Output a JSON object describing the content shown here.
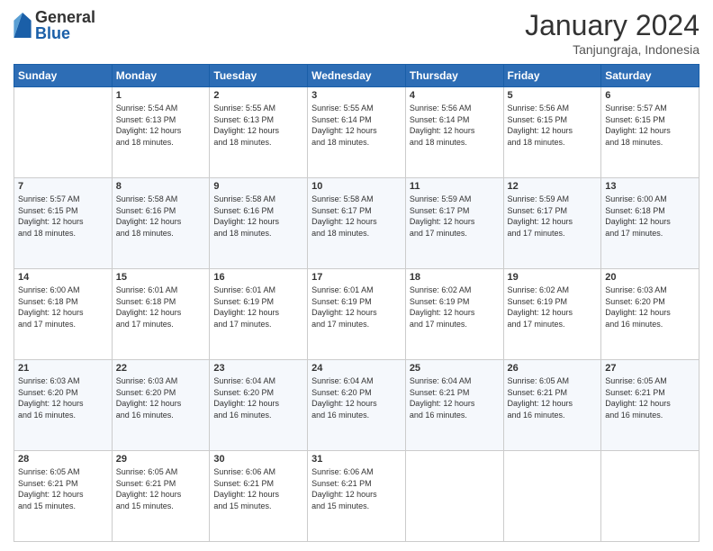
{
  "logo": {
    "general": "General",
    "blue": "Blue"
  },
  "header": {
    "month_year": "January 2024",
    "location": "Tanjungraja, Indonesia"
  },
  "weekdays": [
    "Sunday",
    "Monday",
    "Tuesday",
    "Wednesday",
    "Thursday",
    "Friday",
    "Saturday"
  ],
  "weeks": [
    [
      {
        "day": "",
        "info": ""
      },
      {
        "day": "1",
        "info": "Sunrise: 5:54 AM\nSunset: 6:13 PM\nDaylight: 12 hours\nand 18 minutes."
      },
      {
        "day": "2",
        "info": "Sunrise: 5:55 AM\nSunset: 6:13 PM\nDaylight: 12 hours\nand 18 minutes."
      },
      {
        "day": "3",
        "info": "Sunrise: 5:55 AM\nSunset: 6:14 PM\nDaylight: 12 hours\nand 18 minutes."
      },
      {
        "day": "4",
        "info": "Sunrise: 5:56 AM\nSunset: 6:14 PM\nDaylight: 12 hours\nand 18 minutes."
      },
      {
        "day": "5",
        "info": "Sunrise: 5:56 AM\nSunset: 6:15 PM\nDaylight: 12 hours\nand 18 minutes."
      },
      {
        "day": "6",
        "info": "Sunrise: 5:57 AM\nSunset: 6:15 PM\nDaylight: 12 hours\nand 18 minutes."
      }
    ],
    [
      {
        "day": "7",
        "info": "Sunrise: 5:57 AM\nSunset: 6:15 PM\nDaylight: 12 hours\nand 18 minutes."
      },
      {
        "day": "8",
        "info": "Sunrise: 5:58 AM\nSunset: 6:16 PM\nDaylight: 12 hours\nand 18 minutes."
      },
      {
        "day": "9",
        "info": "Sunrise: 5:58 AM\nSunset: 6:16 PM\nDaylight: 12 hours\nand 18 minutes."
      },
      {
        "day": "10",
        "info": "Sunrise: 5:58 AM\nSunset: 6:17 PM\nDaylight: 12 hours\nand 18 minutes."
      },
      {
        "day": "11",
        "info": "Sunrise: 5:59 AM\nSunset: 6:17 PM\nDaylight: 12 hours\nand 17 minutes."
      },
      {
        "day": "12",
        "info": "Sunrise: 5:59 AM\nSunset: 6:17 PM\nDaylight: 12 hours\nand 17 minutes."
      },
      {
        "day": "13",
        "info": "Sunrise: 6:00 AM\nSunset: 6:18 PM\nDaylight: 12 hours\nand 17 minutes."
      }
    ],
    [
      {
        "day": "14",
        "info": "Sunrise: 6:00 AM\nSunset: 6:18 PM\nDaylight: 12 hours\nand 17 minutes."
      },
      {
        "day": "15",
        "info": "Sunrise: 6:01 AM\nSunset: 6:18 PM\nDaylight: 12 hours\nand 17 minutes."
      },
      {
        "day": "16",
        "info": "Sunrise: 6:01 AM\nSunset: 6:19 PM\nDaylight: 12 hours\nand 17 minutes."
      },
      {
        "day": "17",
        "info": "Sunrise: 6:01 AM\nSunset: 6:19 PM\nDaylight: 12 hours\nand 17 minutes."
      },
      {
        "day": "18",
        "info": "Sunrise: 6:02 AM\nSunset: 6:19 PM\nDaylight: 12 hours\nand 17 minutes."
      },
      {
        "day": "19",
        "info": "Sunrise: 6:02 AM\nSunset: 6:19 PM\nDaylight: 12 hours\nand 17 minutes."
      },
      {
        "day": "20",
        "info": "Sunrise: 6:03 AM\nSunset: 6:20 PM\nDaylight: 12 hours\nand 16 minutes."
      }
    ],
    [
      {
        "day": "21",
        "info": "Sunrise: 6:03 AM\nSunset: 6:20 PM\nDaylight: 12 hours\nand 16 minutes."
      },
      {
        "day": "22",
        "info": "Sunrise: 6:03 AM\nSunset: 6:20 PM\nDaylight: 12 hours\nand 16 minutes."
      },
      {
        "day": "23",
        "info": "Sunrise: 6:04 AM\nSunset: 6:20 PM\nDaylight: 12 hours\nand 16 minutes."
      },
      {
        "day": "24",
        "info": "Sunrise: 6:04 AM\nSunset: 6:20 PM\nDaylight: 12 hours\nand 16 minutes."
      },
      {
        "day": "25",
        "info": "Sunrise: 6:04 AM\nSunset: 6:21 PM\nDaylight: 12 hours\nand 16 minutes."
      },
      {
        "day": "26",
        "info": "Sunrise: 6:05 AM\nSunset: 6:21 PM\nDaylight: 12 hours\nand 16 minutes."
      },
      {
        "day": "27",
        "info": "Sunrise: 6:05 AM\nSunset: 6:21 PM\nDaylight: 12 hours\nand 16 minutes."
      }
    ],
    [
      {
        "day": "28",
        "info": "Sunrise: 6:05 AM\nSunset: 6:21 PM\nDaylight: 12 hours\nand 15 minutes."
      },
      {
        "day": "29",
        "info": "Sunrise: 6:05 AM\nSunset: 6:21 PM\nDaylight: 12 hours\nand 15 minutes."
      },
      {
        "day": "30",
        "info": "Sunrise: 6:06 AM\nSunset: 6:21 PM\nDaylight: 12 hours\nand 15 minutes."
      },
      {
        "day": "31",
        "info": "Sunrise: 6:06 AM\nSunset: 6:21 PM\nDaylight: 12 hours\nand 15 minutes."
      },
      {
        "day": "",
        "info": ""
      },
      {
        "day": "",
        "info": ""
      },
      {
        "day": "",
        "info": ""
      }
    ]
  ]
}
